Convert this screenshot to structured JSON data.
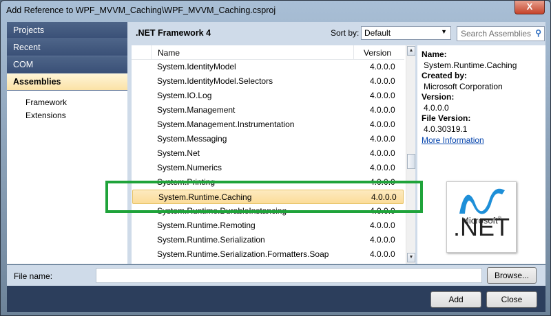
{
  "window": {
    "title": "Add Reference to WPF_MVVM_Caching\\WPF_MVVM_Caching.csproj",
    "close": "X"
  },
  "nav": {
    "items": [
      {
        "label": "Projects"
      },
      {
        "label": "Recent"
      },
      {
        "label": "COM"
      },
      {
        "label": "Assemblies"
      }
    ],
    "sub": [
      "Framework",
      "Extensions"
    ]
  },
  "main": {
    "framework": ".NET Framework 4",
    "sort_label": "Sort by:",
    "sort_value": "Default",
    "search_placeholder": "Search Assemblies"
  },
  "list": {
    "headers": {
      "name": "Name",
      "version": "Version"
    },
    "rows": [
      {
        "name": "System.IdentityModel",
        "version": "4.0.0.0"
      },
      {
        "name": "System.IdentityModel.Selectors",
        "version": "4.0.0.0"
      },
      {
        "name": "System.IO.Log",
        "version": "4.0.0.0"
      },
      {
        "name": "System.Management",
        "version": "4.0.0.0"
      },
      {
        "name": "System.Management.Instrumentation",
        "version": "4.0.0.0"
      },
      {
        "name": "System.Messaging",
        "version": "4.0.0.0"
      },
      {
        "name": "System.Net",
        "version": "4.0.0.0"
      },
      {
        "name": "System.Numerics",
        "version": "4.0.0.0"
      },
      {
        "name": "System.Printing",
        "version": "4.0.0.0"
      },
      {
        "name": "System.Runtime.Caching",
        "version": "4.0.0.0",
        "selected": true
      },
      {
        "name": "System.Runtime.DurableInstancing",
        "version": "4.0.0.0"
      },
      {
        "name": "System.Runtime.Remoting",
        "version": "4.0.0.0"
      },
      {
        "name": "System.Runtime.Serialization",
        "version": "4.0.0.0"
      },
      {
        "name": "System.Runtime.Serialization.Formatters.Soap",
        "version": "4.0.0.0"
      }
    ]
  },
  "detail": {
    "name_label": "Name:",
    "name": "System.Runtime.Caching",
    "created_label": "Created by:",
    "created": "Microsoft Corporation",
    "version_label": "Version:",
    "version": "4.0.0.0",
    "file_version_label": "File Version:",
    "file_version": "4.0.30319.1",
    "more": "More Information",
    "logo_text": "Microsoft .NET"
  },
  "file": {
    "label": "File name:",
    "value": "",
    "browse": "Browse..."
  },
  "footer": {
    "add": "Add",
    "close": "Close"
  },
  "colors": {
    "highlight": "#1fa33a",
    "selection": "#fbdc99"
  }
}
